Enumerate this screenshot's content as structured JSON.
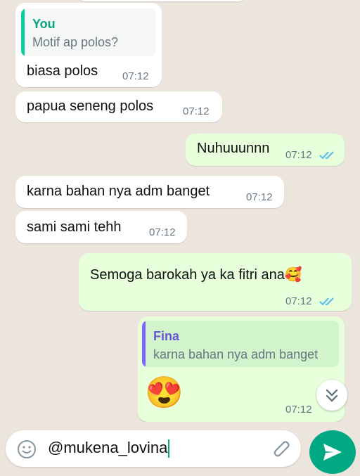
{
  "messages": [
    {
      "quote_author": "You",
      "quote_text": "Motif ap polos?",
      "text": "biasa polos",
      "time": "07:12"
    },
    {
      "text": "papua seneng polos",
      "time": "07:12"
    },
    {
      "text": "Nuhuuunnn",
      "time": "07:12"
    },
    {
      "text": "karna bahan nya adm banget",
      "time": "07:12"
    },
    {
      "text": "sami sami tehh",
      "time": "07:12"
    },
    {
      "text": "Semoga barokah ya ka fitri ana",
      "emoji": "🥰",
      "time": "07:12"
    },
    {
      "quote_author": "Fina",
      "quote_text": "karna bahan nya adm banget",
      "emoji": "😍",
      "time": "07:12"
    }
  ],
  "input": {
    "value": "@mukena_lovina"
  },
  "icons": {
    "emoji_button": "emoji-icon",
    "attach": "paperclip-icon",
    "send": "send-icon",
    "scroll": "chevrons-down-icon",
    "read": "double-check-icon"
  },
  "colors": {
    "outgoing": "#e7ffdb",
    "incoming": "#ffffff",
    "accent": "#00a884",
    "you_quote": "#06cf9c",
    "fina_quote": "#7f66ff",
    "ticks": "#53bdeb"
  }
}
